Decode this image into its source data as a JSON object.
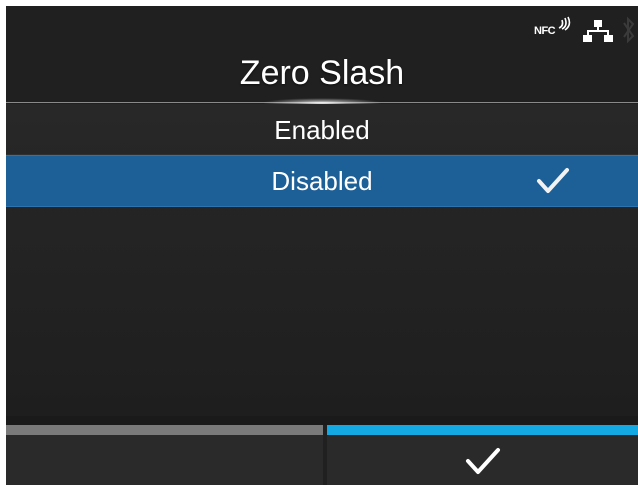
{
  "status_bar": {
    "nfc_label": "NFC",
    "icons": [
      "nfc-icon",
      "network-icon",
      "bluetooth-icon"
    ]
  },
  "header": {
    "title": "Zero Slash"
  },
  "options": [
    {
      "label": "Enabled",
      "selected": false
    },
    {
      "label": "Disabled",
      "selected": true,
      "icon": "check-icon"
    }
  ],
  "footer": {
    "left_button": {
      "label": "",
      "accent_color": "#7a7a7a"
    },
    "right_button": {
      "icon": "check-icon",
      "accent_color": "#15a9e3"
    }
  },
  "colors": {
    "background": "#202020",
    "selected_row": "#1d5f97",
    "text": "#ffffff"
  }
}
